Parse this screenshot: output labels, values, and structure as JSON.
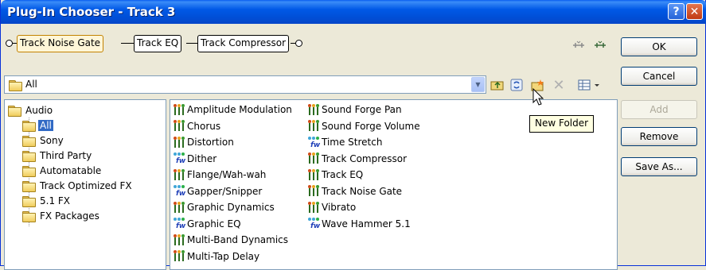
{
  "window": {
    "title": "Plug-In Chooser - Track 3",
    "help_label": "?",
    "close_label": "✕"
  },
  "chain": {
    "items": [
      {
        "label": "Track Noise Gate",
        "selected": true
      },
      {
        "label": "Track EQ",
        "selected": false
      },
      {
        "label": "Track Compressor",
        "selected": false
      }
    ]
  },
  "buttons": {
    "ok": "OK",
    "cancel": "Cancel",
    "add": "Add",
    "remove": "Remove",
    "save_as": "Save As..."
  },
  "location": {
    "value": "All"
  },
  "tooltip": "New Folder",
  "tree": {
    "root": "Audio",
    "children": [
      "All",
      "Sony",
      "Third Party",
      "Automatable",
      "Track Optimized FX",
      "5.1 FX",
      "FX Packages"
    ],
    "selected": "All"
  },
  "plugins": {
    "column1": [
      {
        "label": "Amplitude Modulation",
        "icon": "plugin-icon"
      },
      {
        "label": "Chorus",
        "icon": "plugin-icon"
      },
      {
        "label": "Distortion",
        "icon": "plugin-icon"
      },
      {
        "label": "Dither",
        "icon": "dx-plugin-icon"
      },
      {
        "label": "Flange/Wah-wah",
        "icon": "plugin-icon"
      },
      {
        "label": "Gapper/Snipper",
        "icon": "dx-plugin-icon"
      },
      {
        "label": "Graphic Dynamics",
        "icon": "plugin-icon"
      },
      {
        "label": "Graphic EQ",
        "icon": "dx-plugin-icon"
      },
      {
        "label": "Multi-Band Dynamics",
        "icon": "plugin-icon"
      },
      {
        "label": "Multi-Tap Delay",
        "icon": "plugin-icon"
      }
    ],
    "column2": [
      {
        "label": "Sound Forge Pan",
        "icon": "plugin-icon"
      },
      {
        "label": "Sound Forge Volume",
        "icon": "plugin-icon"
      },
      {
        "label": "Time Stretch",
        "icon": "dx-plugin-icon"
      },
      {
        "label": "Track Compressor",
        "icon": "plugin-icon"
      },
      {
        "label": "Track EQ",
        "icon": "plugin-icon"
      },
      {
        "label": "Track Noise Gate",
        "icon": "plugin-icon"
      },
      {
        "label": "Vibrato",
        "icon": "plugin-icon"
      },
      {
        "label": "Wave Hammer 5.1",
        "icon": "dx-plugin-icon"
      }
    ]
  }
}
